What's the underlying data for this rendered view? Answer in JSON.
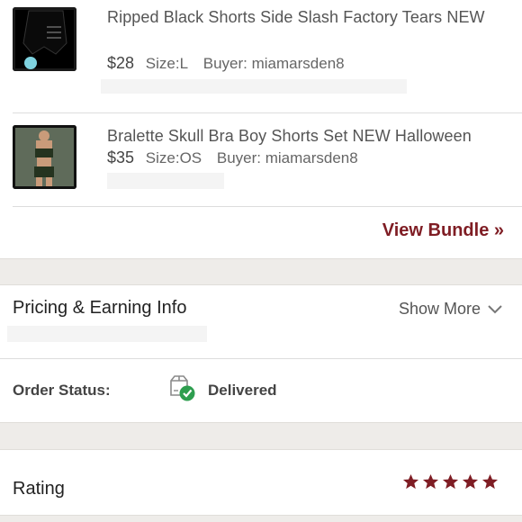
{
  "items": [
    {
      "title": "Ripped Black Shorts Side Slash Factory Tears NEW",
      "price": "$28",
      "size": "Size:L",
      "buyer": "Buyer: miamarsden8",
      "thumb_icon": "black-shorts-photo"
    },
    {
      "title": "Bralette Skull Bra Boy Shorts Set NEW Halloween",
      "price": "$35",
      "size": "Size:OS",
      "buyer": "Buyer: miamarsden8",
      "thumb_icon": "bralette-set-photo"
    }
  ],
  "bundle": {
    "view_label": "View Bundle »"
  },
  "pricing": {
    "title": "Pricing & Earning Info",
    "show_more_label": "Show More",
    "chevron_icon": "chevron-down-icon"
  },
  "order_status": {
    "label": "Order Status:",
    "value": "Delivered",
    "icon": "delivered-box-check-icon"
  },
  "rating": {
    "label": "Rating",
    "stars": 5,
    "star_icon": "star-icon"
  },
  "colors": {
    "accent": "#7f1d24",
    "band": "#eeece9",
    "success": "#2e9e4f"
  }
}
